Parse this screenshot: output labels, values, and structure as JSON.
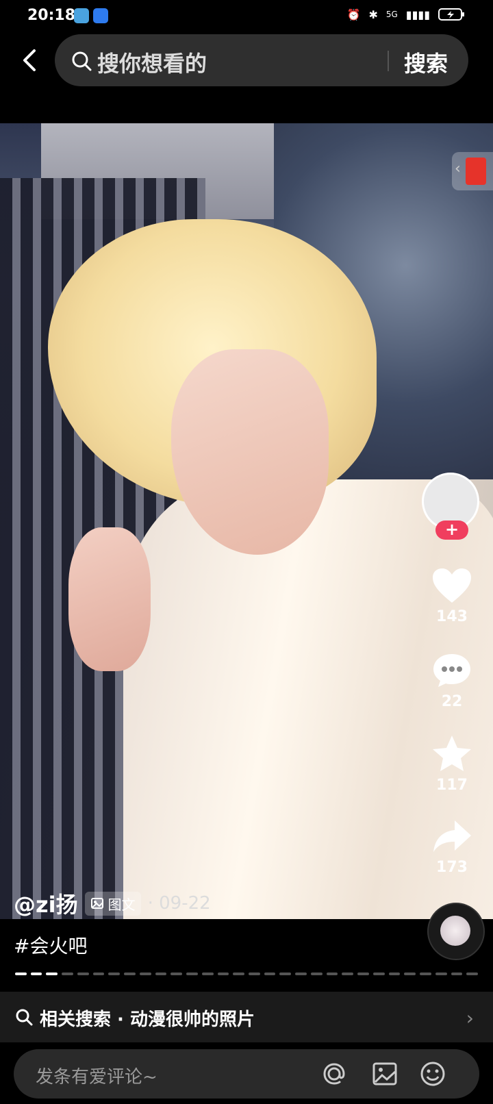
{
  "status_bar": {
    "time": "20:18",
    "right_text": "5G",
    "app_icons": [
      "book-app-icon",
      "browser-app-icon"
    ],
    "indicators": [
      "alarm-icon",
      "bluetooth-icon",
      "signal-icon",
      "battery-icon"
    ]
  },
  "search_bar": {
    "placeholder": "搜你想看的",
    "button_label": "搜索"
  },
  "post": {
    "author": "@zi扬",
    "type_tag": "图文",
    "date": "· 09-22",
    "hashtag": "#会火吧",
    "page_count": 30,
    "active_page": 1
  },
  "actions": {
    "follow_label": "+",
    "likes": "143",
    "comments": "22",
    "favorites": "117",
    "shares": "173"
  },
  "related_search": {
    "label": "相关搜索 · 动漫很帅的照片"
  },
  "comment_bar": {
    "placeholder": "发条有爱评论~"
  },
  "colors": {
    "accent": "#f03e5e",
    "background": "#000000",
    "red_packet": "#e6332a"
  }
}
